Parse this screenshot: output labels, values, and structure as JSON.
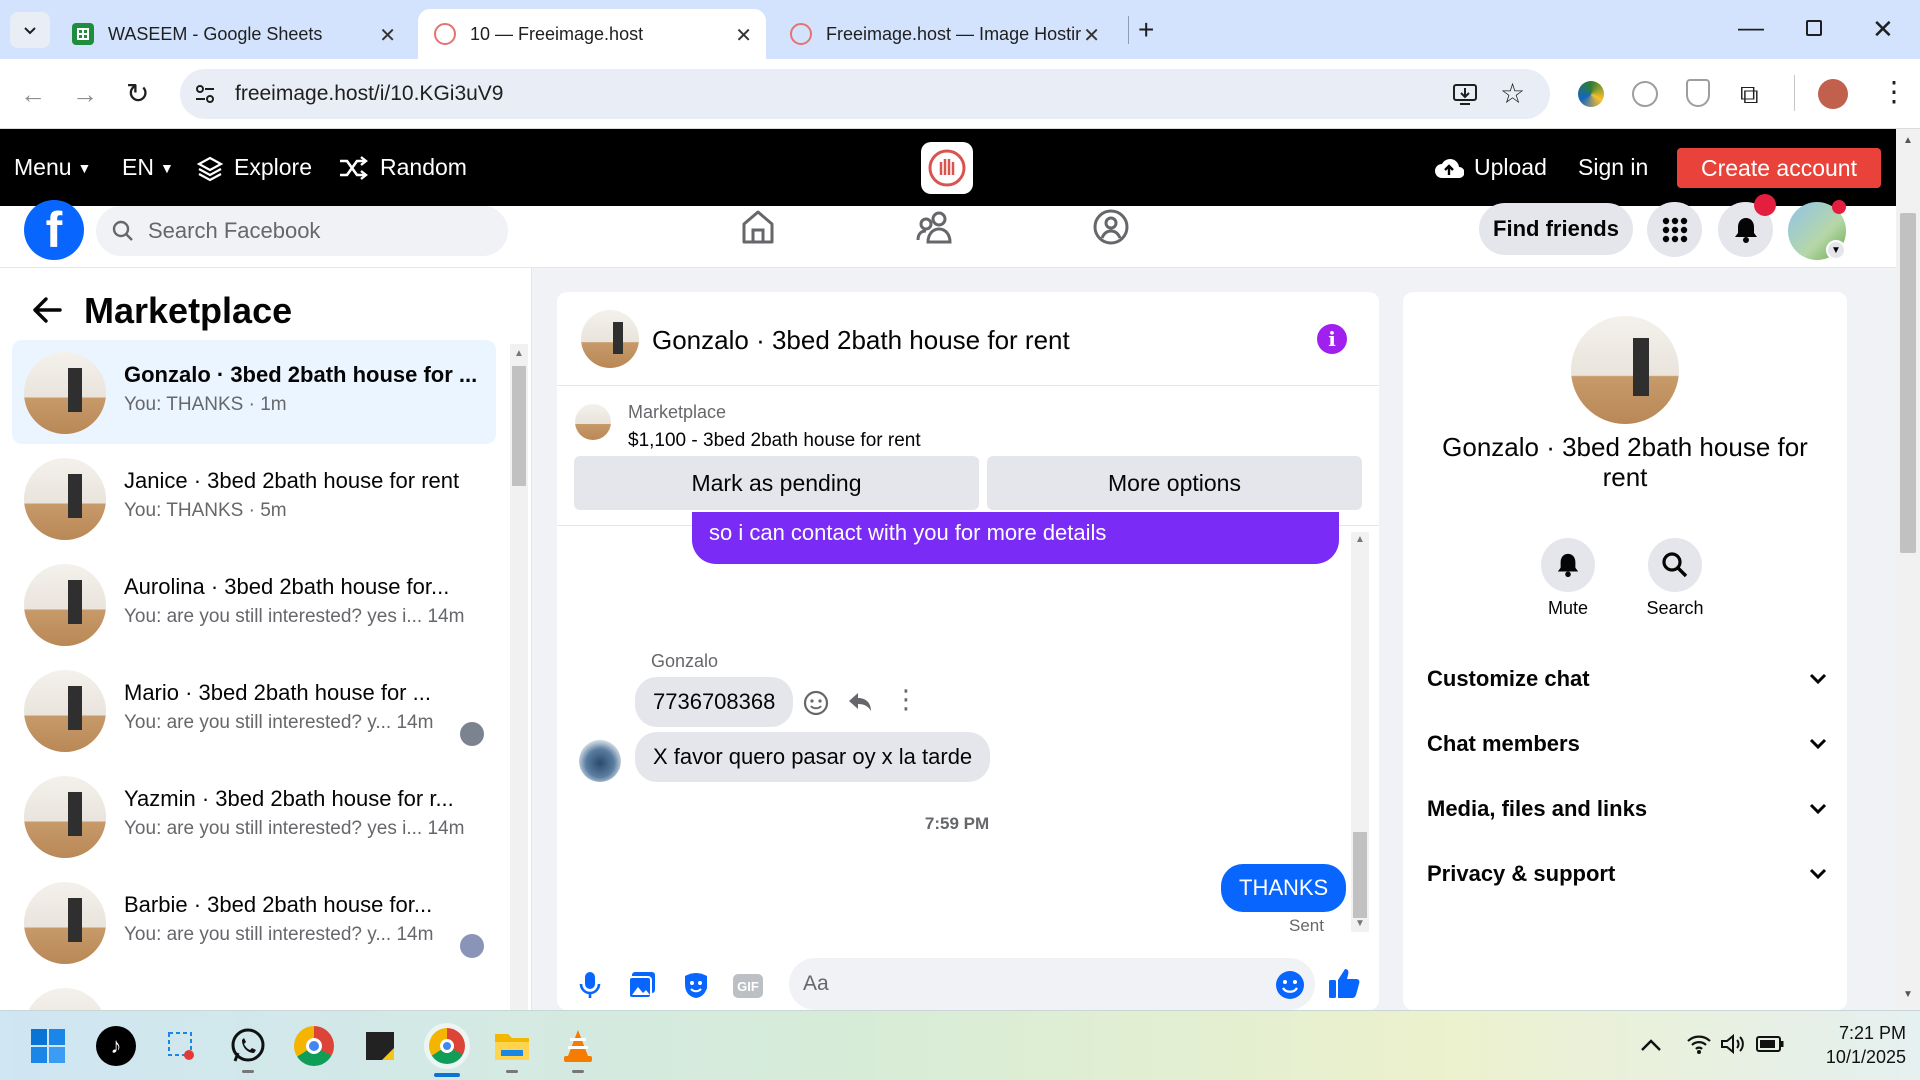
{
  "browser": {
    "tabs": [
      {
        "title": "WASEEM - Google Sheets"
      },
      {
        "title": "10 — Freeimage.host"
      },
      {
        "title": "Freeimage.host — Image Hostir"
      }
    ],
    "url": "freeimage.host/i/10.KGi3uV9"
  },
  "freeimage": {
    "menu": "Menu",
    "lang": "EN",
    "explore": "Explore",
    "random": "Random",
    "upload": "Upload",
    "signin": "Sign in",
    "create": "Create account"
  },
  "facebook": {
    "search_placeholder": "Search Facebook",
    "find_friends": "Find friends"
  },
  "marketplace": {
    "title": "Marketplace",
    "conversations": [
      {
        "name": "Gonzalo · 3bed 2bath house for ...",
        "preview": "You: THANKS · 1m"
      },
      {
        "name": "Janice · 3bed 2bath house for rent",
        "preview": "You: THANKS · 5m"
      },
      {
        "name": "Aurolina · 3bed 2bath house for...",
        "preview": "You: are you still interested? yes i...  14m"
      },
      {
        "name": "Mario · 3bed 2bath house for ...",
        "preview": "You: are you still interested? y...  14m"
      },
      {
        "name": "Yazmin · 3bed 2bath house for r...",
        "preview": "You: are you still interested? yes i...  14m"
      },
      {
        "name": "Barbie · 3bed 2bath house for...",
        "preview": "You: are you still interested? y...  14m"
      }
    ]
  },
  "chat": {
    "title": "Gonzalo · 3bed 2bath house for rent",
    "listing_label": "Marketplace",
    "listing_price": "$1,100 - 3bed 2bath house for rent",
    "mark_pending": "Mark as pending",
    "more_options": "More options",
    "messages": {
      "outgoing_partial": "so i can contact with you for more details",
      "sender_name": "Gonzalo",
      "phone": "7736708368",
      "spanish": "X favor quero pasar oy x la tarde",
      "time": "7:59 PM",
      "thanks": "THANKS",
      "sent": "Sent"
    },
    "input_placeholder": "Aa"
  },
  "details": {
    "title": "Gonzalo · 3bed 2bath house for rent",
    "mute": "Mute",
    "search": "Search",
    "sections": [
      "Customize chat",
      "Chat members",
      "Media, files and links",
      "Privacy & support"
    ]
  },
  "taskbar": {
    "time": "7:21 PM",
    "date": "10/1/2025"
  },
  "colors": {
    "fb_blue": "#0866ff",
    "messenger_purple": "#7a2cf6",
    "create_red": "#e9423a"
  }
}
